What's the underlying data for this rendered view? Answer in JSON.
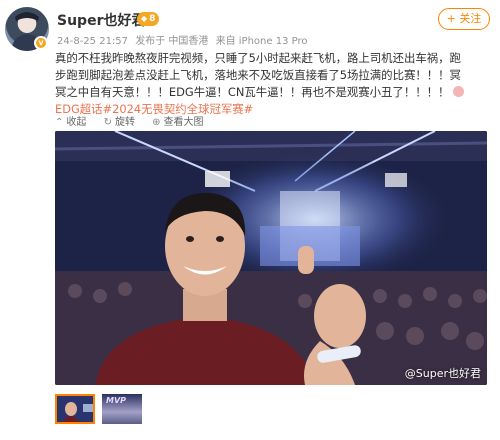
{
  "user": {
    "name": "Super也好君",
    "level_label": "8",
    "avatar_badge": "v"
  },
  "meta": {
    "time": "24-8-25 21:57",
    "posted_from": "发布于 中国香港",
    "device": "来自 iPhone 13 Pro"
  },
  "follow_button": "+ 关注",
  "post": {
    "line1": "真的不枉我昨晚熬夜肝完视频，只睡了5小时起来赶飞机，路上司机还出车祸，跑",
    "line2": "步跑到脚起泡差点没赶上飞机，落地来不及吃饭直接看了5场拉满的比赛！！！冥",
    "line3": "冥之中自有天意！！！EDG牛逼！CN瓦牛逼！！再也不是观赛小丑了！！！！",
    "hashtag": "EDG超话#2024无畏契约全球冠军赛#"
  },
  "actions": {
    "collect": "收起",
    "rotate": "旋转",
    "view_large": "查看大图"
  },
  "photo": {
    "watermark": "@Super也好君"
  },
  "thumbnails": {
    "second_text": "MVP"
  },
  "colors": {
    "accent": "#ff8200",
    "hashtag": "#eb7350",
    "level_badge": "#f5a623"
  }
}
